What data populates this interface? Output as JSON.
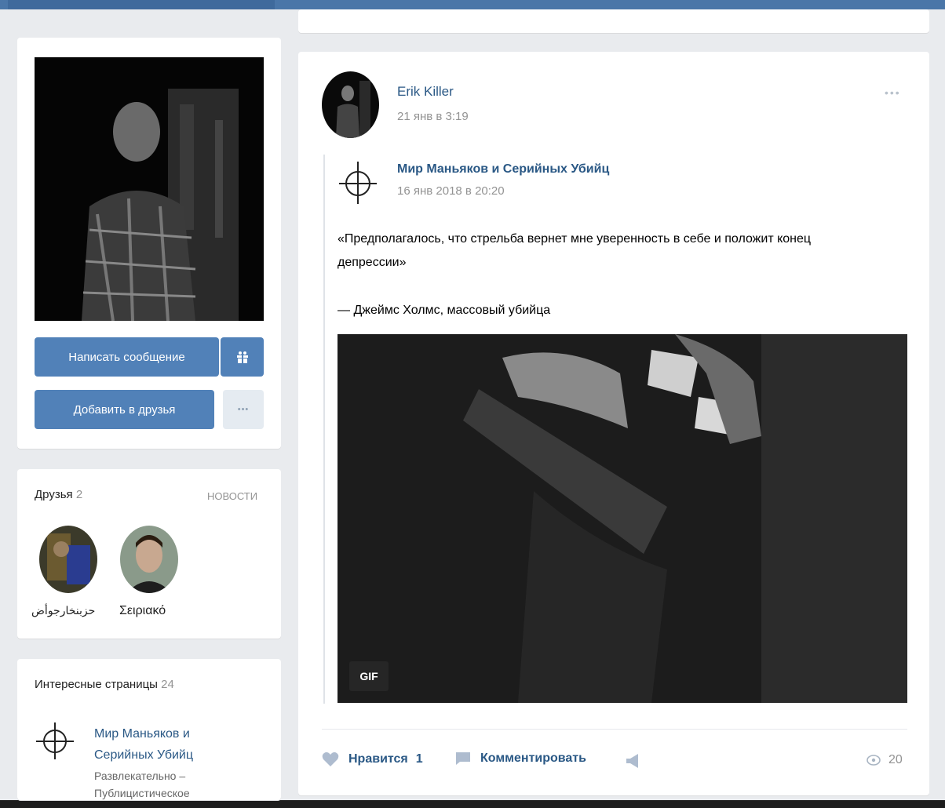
{
  "profile": {
    "write_message_label": "Написать сообщение",
    "add_friend_label": "Добавить в друзья",
    "more_label": "•••"
  },
  "friends": {
    "title": "Друзья",
    "count": "2",
    "news_link": "новости",
    "items": [
      {
        "name": "حزبنخارجوأض"
      },
      {
        "name": "Σειριακό"
      }
    ]
  },
  "interesting": {
    "title": "Интересные страницы",
    "count": "24",
    "item": {
      "name_line1": "Мир Маньяков и",
      "name_line2": "Серийных Убийц",
      "desc_line1": "Развлекательно –",
      "desc_line2": "Публицистическое"
    }
  },
  "post": {
    "author": "Erik Killer",
    "date": "21 янв в 3:19",
    "more_label": "•••",
    "repost": {
      "author": "Мир Маньяков и Серийных Убийц",
      "date": "16 янв 2018 в 20:20",
      "text_line1": "«Предполагалось, что стрельба вернет мне уверенность в себе и положит конец",
      "text_line2": "депрессии»",
      "text_line3": "— Джеймс Холмс, массовый убийца",
      "gif_badge": "GIF"
    },
    "actions": {
      "like_label": "Нравится",
      "like_count": "1",
      "comment_label": "Комментировать",
      "views": "20"
    }
  },
  "colors": {
    "accent": "#4a76a8",
    "link": "#2a5885",
    "button": "#5181b8"
  }
}
